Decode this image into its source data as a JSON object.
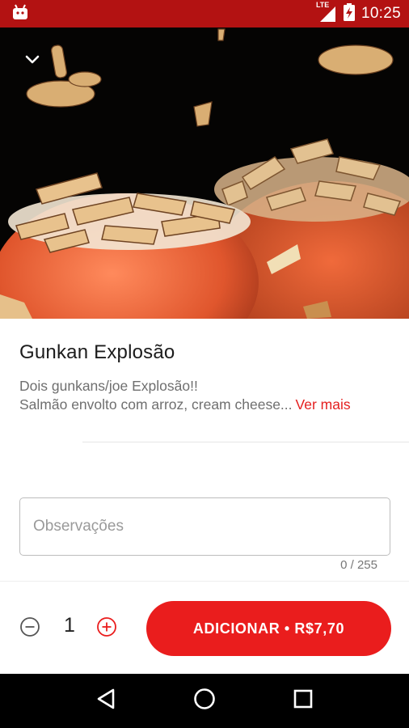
{
  "status_bar": {
    "time": "10:25",
    "network": "LTE",
    "app_icon": "android-icon",
    "signal_icon": "signal-icon",
    "battery_icon": "battery-charging-icon",
    "background_color": "#b31212"
  },
  "hero": {
    "image_description": "",
    "collapse_icon": "chevron-down-icon"
  },
  "item": {
    "title": "Gunkan Explosão",
    "description_line1": "Dois gunkans/joe Explosão!!",
    "description_line2": "Salmão envolto com arroz, cream cheese...",
    "see_more_label": "Ver mais"
  },
  "notes": {
    "placeholder": "Observações",
    "value": "",
    "counter": "0 / 255"
  },
  "order": {
    "minus_icon": "minus-circle-icon",
    "plus_icon": "plus-circle-icon",
    "quantity": "1",
    "add_button_label": "ADICIONAR • R$7,70",
    "accent_color": "#ea1d1d"
  },
  "nav_bar": {
    "back_icon": "back-triangle-icon",
    "home_icon": "home-circle-icon",
    "recents_icon": "recents-square-icon"
  }
}
